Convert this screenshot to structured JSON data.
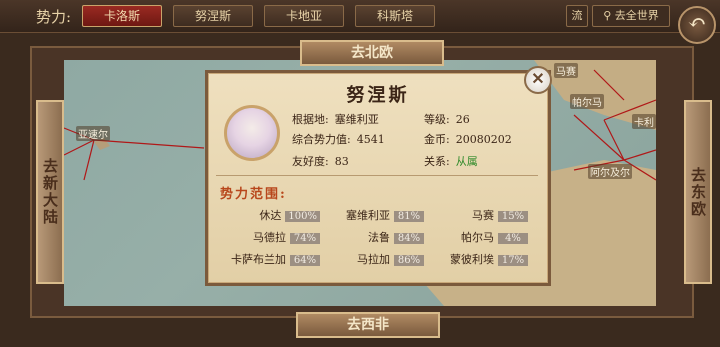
{
  "topbar": {
    "faction_label": "势力:",
    "tabs": [
      "卡洛斯",
      "努涅斯",
      "卡地亚",
      "科斯塔"
    ],
    "liu_label": "流",
    "world_label": "去全世界",
    "back_glyph": "↶"
  },
  "map": {
    "north_label": "去北欧",
    "south_label": "去西非",
    "west_label": "去新大陆",
    "east_label": "去东欧",
    "cities": [
      "亚速尔",
      "马赛",
      "帕尔马",
      "卡利",
      "阿尔及尔"
    ]
  },
  "popup": {
    "title": "努涅斯",
    "close_glyph": "✕",
    "base_label": "根据地:",
    "base_value": "塞维利亚",
    "level_label": "等级:",
    "level_value": "26",
    "power_label": "综合势力值:",
    "power_value": "4541",
    "gold_label": "金币:",
    "gold_value": "20080202",
    "friend_label": "友好度:",
    "friend_value": "83",
    "relation_label": "关系:",
    "relation_value": "从属",
    "scope_title": "势力范围:",
    "territories": [
      {
        "name": "休达",
        "pct": "100%"
      },
      {
        "name": "塞维利亚",
        "pct": "81%"
      },
      {
        "name": "马赛",
        "pct": "15%"
      },
      {
        "name": "马德拉",
        "pct": "74%"
      },
      {
        "name": "法鲁",
        "pct": "84%"
      },
      {
        "name": "帕尔马",
        "pct": "4%"
      },
      {
        "name": "卡萨布兰加",
        "pct": "64%"
      },
      {
        "name": "马拉加",
        "pct": "86%"
      },
      {
        "name": "蒙彼利埃",
        "pct": "17%"
      }
    ]
  },
  "colors": {
    "accent": "#9a2a22",
    "relation": "#2f8a2a",
    "route": "#b01818"
  }
}
